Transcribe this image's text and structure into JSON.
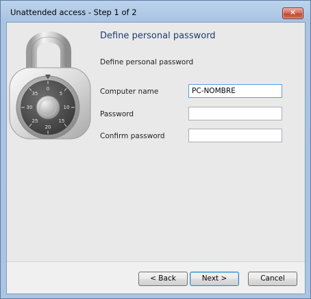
{
  "window": {
    "title": "Unattended access - Step 1 of 2",
    "close_symbol": "✕"
  },
  "main": {
    "header": "Define personal password",
    "subheader": "Define personal password",
    "fields": [
      {
        "label": "Computer name",
        "value": "PC-NOMBRE",
        "placeholder": ""
      },
      {
        "label": "Password",
        "value": "",
        "placeholder": ""
      },
      {
        "label": "Confirm password",
        "value": "",
        "placeholder": ""
      }
    ],
    "illustration": "padlock-icon",
    "dial_numbers": [
      "0",
      "5",
      "10",
      "15",
      "20",
      "25",
      "30",
      "35"
    ]
  },
  "footer": {
    "back_label": "< Back",
    "next_label": "Next >",
    "cancel_label": "Cancel"
  },
  "colors": {
    "title_bar": "#aac5e4",
    "header_text": "#1e3b6f",
    "close_button": "#c24a35"
  }
}
